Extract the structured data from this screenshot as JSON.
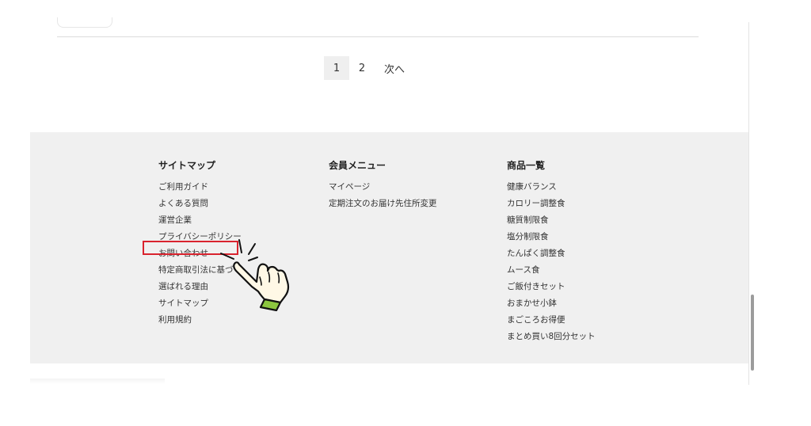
{
  "pagination": {
    "pages": [
      "1",
      "2"
    ],
    "current": "1",
    "next_label": "次へ"
  },
  "footer": {
    "sitemap": {
      "title": "サイトマップ",
      "items": [
        "ご利用ガイド",
        "よくある質問",
        "運営企業",
        "プライバシーポリシー",
        "お問い合わせ",
        "特定商取引法に基づく",
        "選ばれる理由",
        "サイトマップ",
        "利用規約"
      ]
    },
    "member": {
      "title": "会員メニュー",
      "items": [
        "マイページ",
        "定期注文のお届け先住所変更"
      ]
    },
    "products": {
      "title": "商品一覧",
      "items": [
        "健康バランス",
        "カロリー調整食",
        "糖質制限食",
        "塩分制限食",
        "たんぱく調整食",
        "ムース食",
        "ご飯付きセット",
        "おまかせ小鉢",
        "まごころお得便",
        "まとめ買い8回分セット"
      ]
    }
  },
  "annotation": {
    "highlight_color": "#d9232e",
    "pointer_icon": "hand-pointer-icon",
    "pointer_cuff_color": "#8cc63f"
  }
}
